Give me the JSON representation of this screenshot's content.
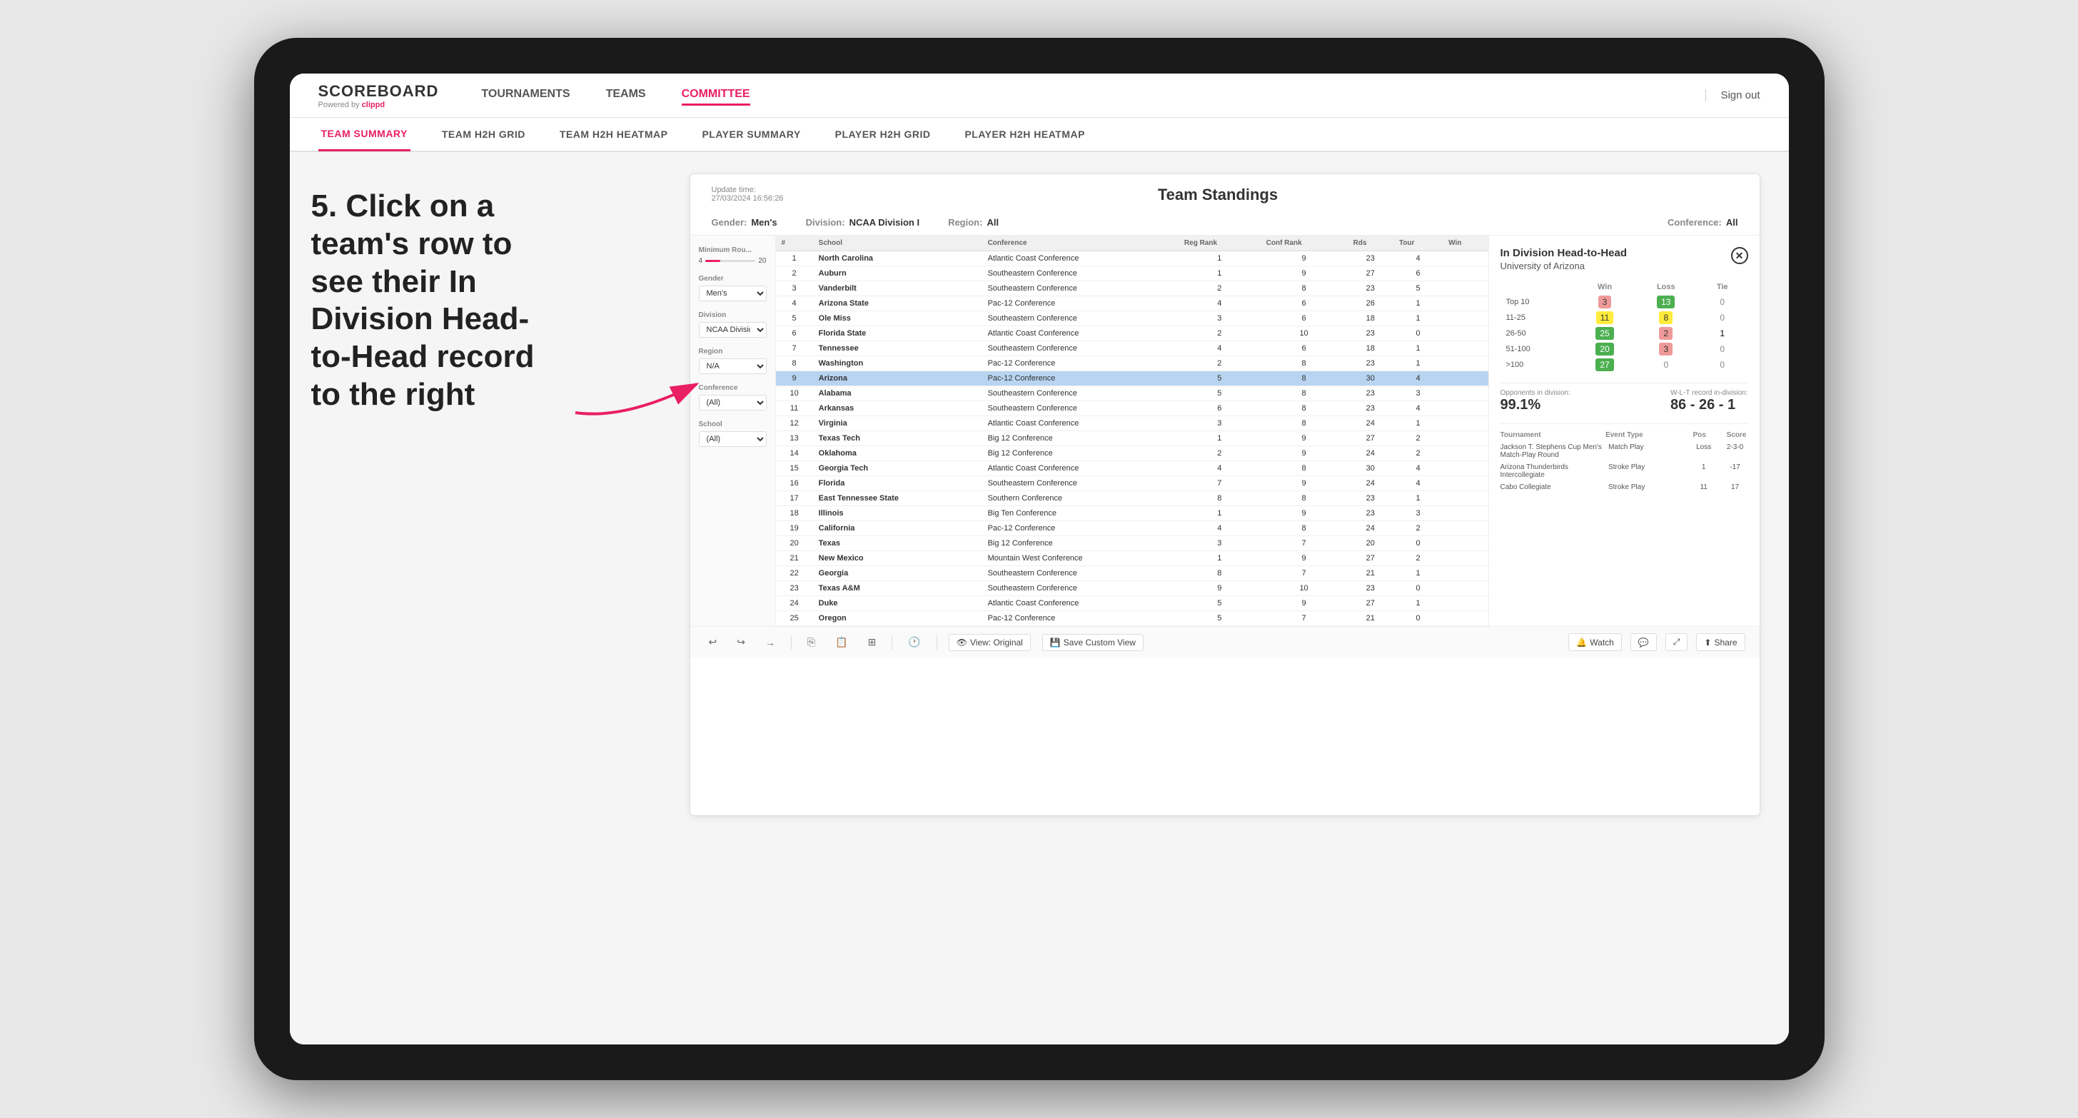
{
  "page": {
    "background": "#e8e8e8"
  },
  "annotation": {
    "text": "5. Click on a team's row to see their In Division Head-to-Head record to the right"
  },
  "nav": {
    "logo_title": "SCOREBOARD",
    "logo_subtitle": "Powered by",
    "logo_brand": "clippd",
    "items": [
      {
        "label": "TOURNAMENTS",
        "active": false
      },
      {
        "label": "TEAMS",
        "active": false
      },
      {
        "label": "COMMITTEE",
        "active": true
      }
    ],
    "sign_out": "Sign out"
  },
  "sub_nav": {
    "items": [
      {
        "label": "TEAM SUMMARY",
        "active": true
      },
      {
        "label": "TEAM H2H GRID",
        "active": false
      },
      {
        "label": "TEAM H2H HEATMAP",
        "active": false
      },
      {
        "label": "PLAYER SUMMARY",
        "active": false
      },
      {
        "label": "PLAYER H2H GRID",
        "active": false
      },
      {
        "label": "PLAYER H2H HEATMAP",
        "active": false
      }
    ]
  },
  "panel": {
    "update_time_label": "Update time:",
    "update_time": "27/03/2024 16:56:26",
    "title": "Team Standings",
    "gender_label": "Gender:",
    "gender_value": "Men's",
    "division_label": "Division:",
    "division_value": "NCAA Division I",
    "region_label": "Region:",
    "region_value": "All",
    "conference_label": "Conference:",
    "conference_value": "All"
  },
  "filters": {
    "minimum_rounds_label": "Minimum Rou...",
    "minimum_rounds_value": "4",
    "minimum_rounds_max": "20",
    "gender_label": "Gender",
    "gender_options": [
      "Men's"
    ],
    "division_label": "Division",
    "division_options": [
      "NCAA Division I"
    ],
    "region_label": "Region",
    "region_value": "N/A",
    "conference_label": "Conference",
    "conference_value": "(All)",
    "school_label": "School",
    "school_value": "(All)"
  },
  "table": {
    "headers": [
      "#",
      "School",
      "Conference",
      "Reg Rank",
      "Conf Rank",
      "Rds",
      "Tour",
      "Win"
    ],
    "rows": [
      {
        "rank": 1,
        "school": "North Carolina",
        "conference": "Atlantic Coast Conference",
        "reg_rank": 1,
        "conf_rank": 9,
        "rds": 23,
        "tour": 4,
        "win": ""
      },
      {
        "rank": 2,
        "school": "Auburn",
        "conference": "Southeastern Conference",
        "reg_rank": 1,
        "conf_rank": 9,
        "rds": 27,
        "tour": 6,
        "win": ""
      },
      {
        "rank": 3,
        "school": "Vanderbilt",
        "conference": "Southeastern Conference",
        "reg_rank": 2,
        "conf_rank": 8,
        "rds": 23,
        "tour": 5,
        "win": ""
      },
      {
        "rank": 4,
        "school": "Arizona State",
        "conference": "Pac-12 Conference",
        "reg_rank": 4,
        "conf_rank": 6,
        "rds": 26,
        "tour": 1,
        "win": ""
      },
      {
        "rank": 5,
        "school": "Ole Miss",
        "conference": "Southeastern Conference",
        "reg_rank": 3,
        "conf_rank": 6,
        "rds": 18,
        "tour": 1,
        "win": ""
      },
      {
        "rank": 6,
        "school": "Florida State",
        "conference": "Atlantic Coast Conference",
        "reg_rank": 2,
        "conf_rank": 10,
        "rds": 23,
        "tour": 0,
        "win": ""
      },
      {
        "rank": 7,
        "school": "Tennessee",
        "conference": "Southeastern Conference",
        "reg_rank": 4,
        "conf_rank": 6,
        "rds": 18,
        "tour": 1,
        "win": ""
      },
      {
        "rank": 8,
        "school": "Washington",
        "conference": "Pac-12 Conference",
        "reg_rank": 2,
        "conf_rank": 8,
        "rds": 23,
        "tour": 1,
        "win": ""
      },
      {
        "rank": 9,
        "school": "Arizona",
        "conference": "Pac-12 Conference",
        "reg_rank": 5,
        "conf_rank": 8,
        "rds": 30,
        "tour": 4,
        "win": "",
        "highlighted": true
      },
      {
        "rank": 10,
        "school": "Alabama",
        "conference": "Southeastern Conference",
        "reg_rank": 5,
        "conf_rank": 8,
        "rds": 23,
        "tour": 3,
        "win": ""
      },
      {
        "rank": 11,
        "school": "Arkansas",
        "conference": "Southeastern Conference",
        "reg_rank": 6,
        "conf_rank": 8,
        "rds": 23,
        "tour": 4,
        "win": ""
      },
      {
        "rank": 12,
        "school": "Virginia",
        "conference": "Atlantic Coast Conference",
        "reg_rank": 3,
        "conf_rank": 8,
        "rds": 24,
        "tour": 1,
        "win": ""
      },
      {
        "rank": 13,
        "school": "Texas Tech",
        "conference": "Big 12 Conference",
        "reg_rank": 1,
        "conf_rank": 9,
        "rds": 27,
        "tour": 2,
        "win": ""
      },
      {
        "rank": 14,
        "school": "Oklahoma",
        "conference": "Big 12 Conference",
        "reg_rank": 2,
        "conf_rank": 9,
        "rds": 24,
        "tour": 2,
        "win": ""
      },
      {
        "rank": 15,
        "school": "Georgia Tech",
        "conference": "Atlantic Coast Conference",
        "reg_rank": 4,
        "conf_rank": 8,
        "rds": 30,
        "tour": 4,
        "win": ""
      },
      {
        "rank": 16,
        "school": "Florida",
        "conference": "Southeastern Conference",
        "reg_rank": 7,
        "conf_rank": 9,
        "rds": 24,
        "tour": 4,
        "win": ""
      },
      {
        "rank": 17,
        "school": "East Tennessee State",
        "conference": "Southern Conference",
        "reg_rank": 8,
        "conf_rank": 8,
        "rds": 23,
        "tour": 1,
        "win": ""
      },
      {
        "rank": 18,
        "school": "Illinois",
        "conference": "Big Ten Conference",
        "reg_rank": 1,
        "conf_rank": 9,
        "rds": 23,
        "tour": 3,
        "win": ""
      },
      {
        "rank": 19,
        "school": "California",
        "conference": "Pac-12 Conference",
        "reg_rank": 4,
        "conf_rank": 8,
        "rds": 24,
        "tour": 2,
        "win": ""
      },
      {
        "rank": 20,
        "school": "Texas",
        "conference": "Big 12 Conference",
        "reg_rank": 3,
        "conf_rank": 7,
        "rds": 20,
        "tour": 0,
        "win": ""
      },
      {
        "rank": 21,
        "school": "New Mexico",
        "conference": "Mountain West Conference",
        "reg_rank": 1,
        "conf_rank": 9,
        "rds": 27,
        "tour": 2,
        "win": ""
      },
      {
        "rank": 22,
        "school": "Georgia",
        "conference": "Southeastern Conference",
        "reg_rank": 8,
        "conf_rank": 7,
        "rds": 21,
        "tour": 1,
        "win": ""
      },
      {
        "rank": 23,
        "school": "Texas A&M",
        "conference": "Southeastern Conference",
        "reg_rank": 9,
        "conf_rank": 10,
        "rds": 23,
        "tour": 0,
        "win": ""
      },
      {
        "rank": 24,
        "school": "Duke",
        "conference": "Atlantic Coast Conference",
        "reg_rank": 5,
        "conf_rank": 9,
        "rds": 27,
        "tour": 1,
        "win": ""
      },
      {
        "rank": 25,
        "school": "Oregon",
        "conference": "Pac-12 Conference",
        "reg_rank": 5,
        "conf_rank": 7,
        "rds": 21,
        "tour": 0,
        "win": ""
      }
    ]
  },
  "h2h": {
    "title": "In Division Head-to-Head",
    "team": "University of Arizona",
    "headers": [
      "",
      "Win",
      "Loss",
      "Tie"
    ],
    "rows": [
      {
        "range": "Top 10",
        "win": 3,
        "loss": 13,
        "tie": 0,
        "win_class": "cell-red-light",
        "loss_class": "cell-green"
      },
      {
        "range": "11-25",
        "win": 11,
        "loss": 8,
        "tie": 0,
        "win_class": "cell-yellow",
        "loss_class": "cell-yellow"
      },
      {
        "range": "26-50",
        "win": 25,
        "loss": 2,
        "tie": 1,
        "win_class": "cell-green",
        "loss_class": "cell-red-light"
      },
      {
        "range": "51-100",
        "win": 20,
        "loss": 3,
        "tie": 0,
        "win_class": "cell-green",
        "loss_class": "cell-red-light"
      },
      {
        "range": ">100",
        "win": 27,
        "loss": 0,
        "tie": 0,
        "win_class": "cell-green",
        "loss_class": "cell-zero"
      }
    ],
    "opponents_label": "Opponents in division:",
    "opponents_value": "99.1%",
    "wlt_label": "W-L-T record in-division:",
    "wlt_value": "86 - 26 - 1",
    "tournament_header": [
      "Tournament",
      "Event Type",
      "Pos",
      "Score"
    ],
    "tournaments": [
      {
        "name": "Jackson T. Stephens Cup Men's Match-Play Round",
        "type": "Match Play",
        "pos": "Loss",
        "score": "2-3-0"
      },
      {
        "name": "Arizona Thunderbirds Intercollegiate",
        "type": "Stroke Play",
        "pos": "1",
        "score": "-17"
      },
      {
        "name": "Cabo Collegiate",
        "type": "Stroke Play",
        "pos": "11",
        "score": "17"
      }
    ]
  },
  "toolbar": {
    "icons": [
      "undo",
      "redo",
      "forward",
      "copy",
      "paste",
      "clock",
      "view-original",
      "save-custom",
      "watch",
      "comment",
      "share"
    ],
    "view_original": "View: Original",
    "save_custom": "Save Custom View",
    "watch": "Watch",
    "share": "Share"
  }
}
